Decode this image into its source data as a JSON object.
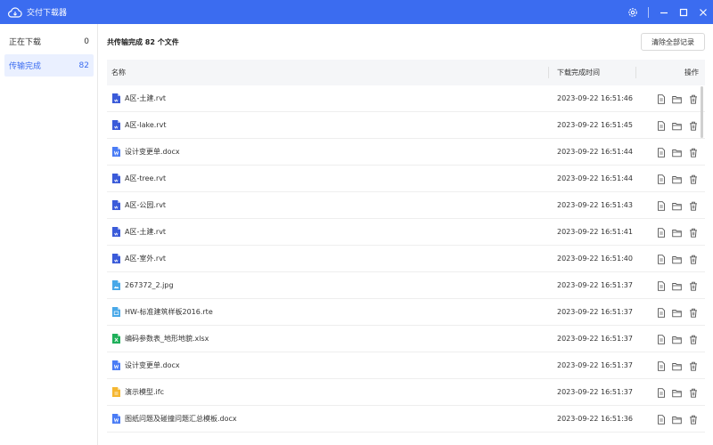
{
  "app": {
    "title": "交付下载器",
    "accent": "#3b6cf0"
  },
  "sidebar": {
    "items": [
      {
        "label": "正在下载",
        "count": "0",
        "active": false
      },
      {
        "label": "传输完成",
        "count": "82",
        "active": true
      }
    ]
  },
  "main": {
    "summary": "共传输完成 82 个文件",
    "clear_button": "清除全部记录",
    "columns": {
      "name": "名称",
      "time": "下载完成时间",
      "ops": "操作"
    },
    "rows": [
      {
        "name": "A区-土建.rvt",
        "time": "2023-09-22 16:51:46",
        "type": "rvt"
      },
      {
        "name": "A区-lake.rvt",
        "time": "2023-09-22 16:51:45",
        "type": "rvt"
      },
      {
        "name": "设计变更单.docx",
        "time": "2023-09-22 16:51:44",
        "type": "docx"
      },
      {
        "name": "A区-tree.rvt",
        "time": "2023-09-22 16:51:44",
        "type": "rvt"
      },
      {
        "name": "A区-公园.rvt",
        "time": "2023-09-22 16:51:43",
        "type": "rvt"
      },
      {
        "name": "A区-土建.rvt",
        "time": "2023-09-22 16:51:41",
        "type": "rvt"
      },
      {
        "name": "A区-室外.rvt",
        "time": "2023-09-22 16:51:40",
        "type": "rvt"
      },
      {
        "name": "267372_2.jpg",
        "time": "2023-09-22 16:51:37",
        "type": "jpg"
      },
      {
        "name": "HW-标准建筑样板2016.rte",
        "time": "2023-09-22 16:51:37",
        "type": "rte"
      },
      {
        "name": "编码参数表_地形地貌.xlsx",
        "time": "2023-09-22 16:51:37",
        "type": "xlsx"
      },
      {
        "name": "设计变更单.docx",
        "time": "2023-09-22 16:51:37",
        "type": "docx"
      },
      {
        "name": "演示模型.ifc",
        "time": "2023-09-22 16:51:37",
        "type": "ifc"
      },
      {
        "name": "图纸问题及碰撞问题汇总模板.docx",
        "time": "2023-09-22 16:51:36",
        "type": "docx"
      }
    ]
  },
  "icons": {
    "file_colors": {
      "rvt": "#3b5bd9",
      "docx": "#4a7cf5",
      "jpg": "#48a8e8",
      "rte": "#48a8e8",
      "xlsx": "#1fb05a",
      "ifc": "#f5b731"
    },
    "row_ops": [
      "open-file-icon",
      "open-folder-icon",
      "delete-icon"
    ]
  }
}
